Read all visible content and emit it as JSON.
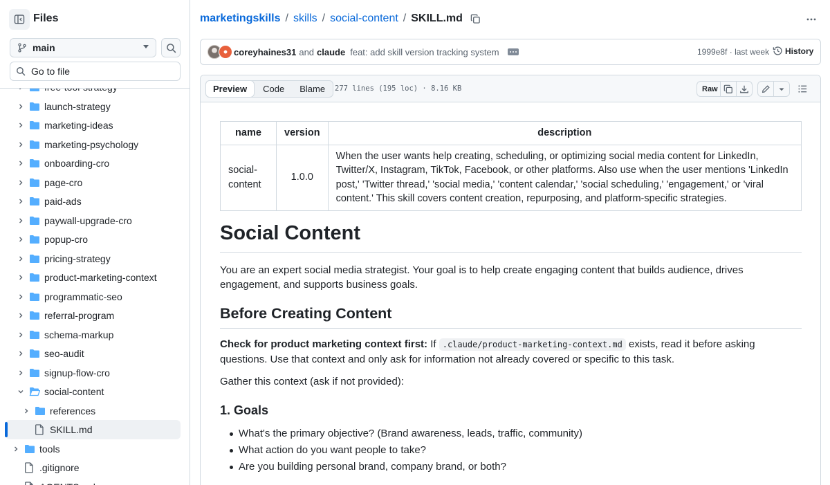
{
  "sidebar": {
    "title": "Files",
    "branch": "main",
    "goto_placeholder": "Go to file",
    "items": [
      {
        "label": "free-tool-strategy",
        "type": "folder",
        "depth": 0,
        "expanded": false
      },
      {
        "label": "launch-strategy",
        "type": "folder",
        "depth": 0,
        "expanded": false
      },
      {
        "label": "marketing-ideas",
        "type": "folder",
        "depth": 0,
        "expanded": false
      },
      {
        "label": "marketing-psychology",
        "type": "folder",
        "depth": 0,
        "expanded": false
      },
      {
        "label": "onboarding-cro",
        "type": "folder",
        "depth": 0,
        "expanded": false
      },
      {
        "label": "page-cro",
        "type": "folder",
        "depth": 0,
        "expanded": false
      },
      {
        "label": "paid-ads",
        "type": "folder",
        "depth": 0,
        "expanded": false
      },
      {
        "label": "paywall-upgrade-cro",
        "type": "folder",
        "depth": 0,
        "expanded": false
      },
      {
        "label": "popup-cro",
        "type": "folder",
        "depth": 0,
        "expanded": false
      },
      {
        "label": "pricing-strategy",
        "type": "folder",
        "depth": 0,
        "expanded": false
      },
      {
        "label": "product-marketing-context",
        "type": "folder",
        "depth": 0,
        "expanded": false
      },
      {
        "label": "programmatic-seo",
        "type": "folder",
        "depth": 0,
        "expanded": false
      },
      {
        "label": "referral-program",
        "type": "folder",
        "depth": 0,
        "expanded": false
      },
      {
        "label": "schema-markup",
        "type": "folder",
        "depth": 0,
        "expanded": false
      },
      {
        "label": "seo-audit",
        "type": "folder",
        "depth": 0,
        "expanded": false
      },
      {
        "label": "signup-flow-cro",
        "type": "folder",
        "depth": 0,
        "expanded": false
      },
      {
        "label": "social-content",
        "type": "folder",
        "depth": 0,
        "expanded": true
      },
      {
        "label": "references",
        "type": "folder",
        "depth": 1,
        "expanded": false
      },
      {
        "label": "SKILL.md",
        "type": "file",
        "depth": 1,
        "selected": true
      },
      {
        "label": "tools",
        "type": "folder",
        "depth": -1,
        "expanded": false
      },
      {
        "label": ".gitignore",
        "type": "file",
        "depth": -1
      },
      {
        "label": "AGENTS.md",
        "type": "file",
        "depth": -1
      }
    ]
  },
  "breadcrumb": {
    "repo": "marketingskills",
    "parts": [
      "skills",
      "social-content"
    ],
    "file": "SKILL.md"
  },
  "commit": {
    "author1": "coreyhaines31",
    "and_text": "and",
    "author2": "claude",
    "message": "feat: add skill version tracking system",
    "sha": "1999e8f",
    "when": "last week",
    "history_label": "History"
  },
  "file_view": {
    "tabs": [
      "Preview",
      "Code",
      "Blame"
    ],
    "active_tab": "Preview",
    "stats": "277 lines (195 loc) · 8.16 KB",
    "raw_label": "Raw"
  },
  "frontmatter": {
    "headers": [
      "name",
      "version",
      "description"
    ],
    "name": "social-content",
    "version": "1.0.0",
    "description": "When the user wants help creating, scheduling, or optimizing social media content for LinkedIn, Twitter/X, Instagram, TikTok, Facebook, or other platforms. Also use when the user mentions 'LinkedIn post,' 'Twitter thread,' 'social media,' 'content calendar,' 'social scheduling,' 'engagement,' or 'viral content.' This skill covers content creation, repurposing, and platform-specific strategies."
  },
  "content": {
    "h1": "Social Content",
    "intro": "You are an expert social media strategist. Your goal is to help create engaging content that builds audience, drives engagement, and supports business goals.",
    "h2": "Before Creating Content",
    "check_bold": "Check for product marketing context first:",
    "check_if": "If",
    "check_code": ".claude/product-marketing-context.md",
    "check_rest": "exists, read it before asking questions. Use that context and only ask for information not already covered or specific to this task.",
    "gather": "Gather this context (ask if not provided):",
    "h3": "1. Goals",
    "bullets": [
      "What's the primary objective? (Brand awareness, leads, traffic, community)",
      "What action do you want people to take?",
      "Are you building personal brand, company brand, or both?"
    ]
  },
  "colors": {
    "link": "#0969da",
    "folder": "#54aeff",
    "border": "#d1d9e0",
    "text": "#1f2328",
    "muted": "#59636e"
  }
}
